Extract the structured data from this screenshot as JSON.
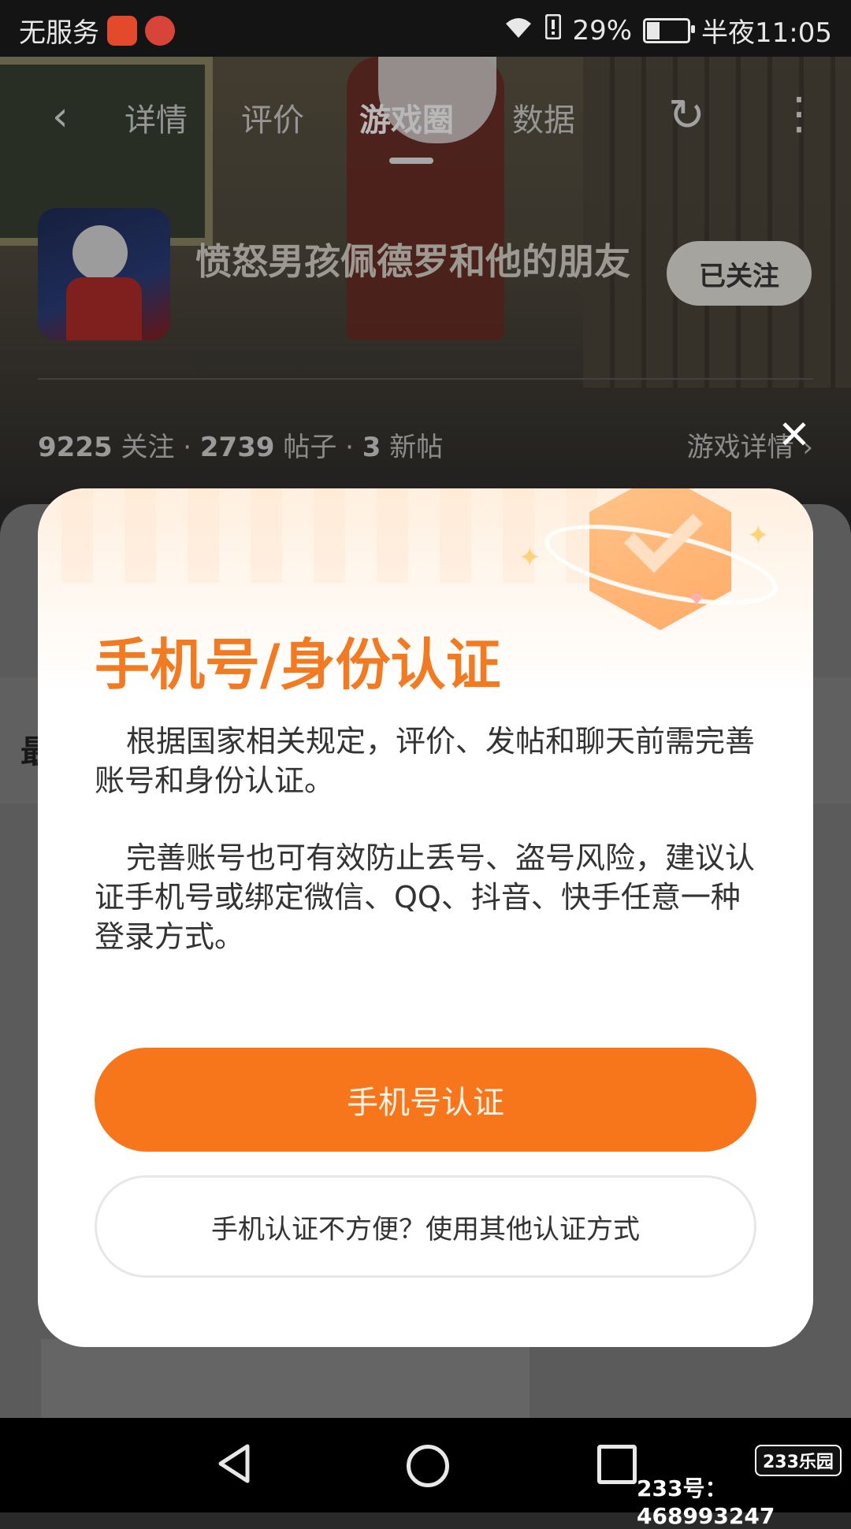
{
  "status_bar": {
    "carrier": "无服务",
    "battery_percent": "29%",
    "battery_level": 0.29,
    "time": "半夜11:05"
  },
  "nav": {
    "tabs": [
      {
        "label": "详情"
      },
      {
        "label": "评价"
      },
      {
        "label": "游戏圈"
      },
      {
        "label": "数据"
      }
    ],
    "active_tab": "游戏圈"
  },
  "game": {
    "title": "愤怒男孩佩德罗和他的朋友",
    "follow_label": "已关注",
    "stats": {
      "followers": "9225",
      "followers_label": "关注",
      "posts": "2739",
      "posts_label": "帖子",
      "new_posts": "3",
      "new_posts_label": "新帖"
    },
    "detail_link": "游戏详情"
  },
  "content": {
    "partial_heading": "最"
  },
  "dialog": {
    "title": "手机号/身份认证",
    "paragraph_1": "根据国家相关规定，评价、发帖和聊天前需完善账号和身份认证。",
    "paragraph_2": "完善账号也可有效防止丢号、盗号风险，建议认证手机号或绑定微信、QQ、抖音、快手任意一种登录方式。",
    "primary_button": "手机号认证",
    "secondary_button": "手机认证不方便？使用其他认证方式",
    "accent_color": "#f8761b",
    "title_color": "#f27a22"
  },
  "watermark": {
    "logo": "233乐园",
    "id_text": "233号：468993247"
  }
}
